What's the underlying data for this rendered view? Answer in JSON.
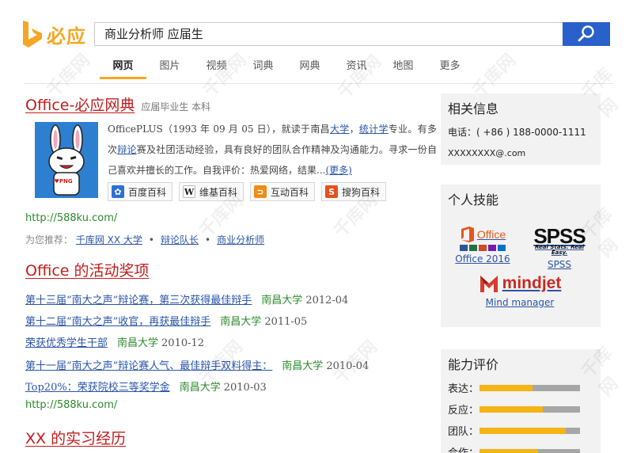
{
  "brand": {
    "name": "必应",
    "color": "#f5a623"
  },
  "search": {
    "query": "商业分析师 应届生",
    "button_icon": "search-icon"
  },
  "tabs": [
    "网页",
    "图片",
    "视频",
    "词典",
    "网典",
    "资讯",
    "地图",
    "更多"
  ],
  "result": {
    "title": "Office-必应网典",
    "subtitle": "应届毕业生 本科",
    "profile_text": "I♥PNG",
    "bio": {
      "p1": "OfficePLUS（1993 年 09 月 05 日），就读于南昌",
      "l1": "大学",
      "p2": "，",
      "l2": "统计学",
      "p3": "专业。有多次",
      "l3": "辩论",
      "p4": "赛及社团活动经验，具有良好的团队合作精神及沟通能力。寻求一份自己喜欢并擅长的工作。自我评价：热爱网络，结果...",
      "more": "(更多)"
    },
    "encyclopedias": [
      {
        "label": "百度百科",
        "icon": "baidu-paw-icon",
        "color": "#2d6fd6"
      },
      {
        "label": "维基百科",
        "icon": "wikipedia-w-icon",
        "color": "#444444"
      },
      {
        "label": "互动百科",
        "icon": "hudong-icon",
        "color": "#f08c1a"
      },
      {
        "label": "搜狗百科",
        "icon": "sogou-s-icon",
        "color": "#e8501e"
      }
    ],
    "url": "http://588ku.com/",
    "recommend": {
      "label": "为您推荐：",
      "items": [
        "千库网 XX 大学",
        "辩论队长",
        "商业分析师"
      ]
    }
  },
  "awards_section": {
    "title": "Office 的活动奖项",
    "items": [
      {
        "name": "第十三届“南大之声”辩论赛，第三次获得最佳辩手",
        "school": "南昌大学",
        "date": "2012-04"
      },
      {
        "name": "第十二届“南大之声”收官，再获最佳辩手",
        "school": "南昌大学",
        "date": "2011-05"
      },
      {
        "name": "荣获优秀学生干部",
        "school": "南昌大学",
        "date": "2010-12"
      },
      {
        "name": "第十一届“南大之声”辩论赛人气、最佳辩手双料得主：",
        "school": "南昌大学",
        "date": "2010-04"
      },
      {
        "name": "Top20%：荣获院校三等奖学金",
        "school": "南昌大学",
        "date": "2010-03"
      }
    ],
    "url": "http://588ku.com/"
  },
  "internship_section": {
    "title": "XX 的实习经历"
  },
  "sidebar": {
    "info": {
      "title": "相关信息",
      "phone": "电话：( +86 ) 188-0000-1111",
      "email": "XXXXXXXX@.com"
    },
    "skills": {
      "title": "个人技能",
      "office_logo": "Office",
      "spss_logo": "SPSS",
      "spss_tagline": "Real Stats. Real Easy.",
      "mindjet_logo": "mindjet",
      "items": [
        {
          "label": "Office 2016",
          "icon": "office-logo-icon"
        },
        {
          "label": "SPSS",
          "icon": "spss-logo-icon"
        },
        {
          "label": "Mind manager",
          "icon": "mindjet-logo-icon"
        }
      ]
    },
    "ratings": {
      "title": "能力评价",
      "items": [
        {
          "label": "表达：",
          "value": 0.53
        },
        {
          "label": "反应：",
          "value": 0.63
        },
        {
          "label": "团队：",
          "value": 0.86
        },
        {
          "label": "合作：",
          "value": 0.58
        }
      ],
      "fill_color": "#f5b316",
      "track_color": "#a6a6a6"
    }
  },
  "watermark": "千库网"
}
